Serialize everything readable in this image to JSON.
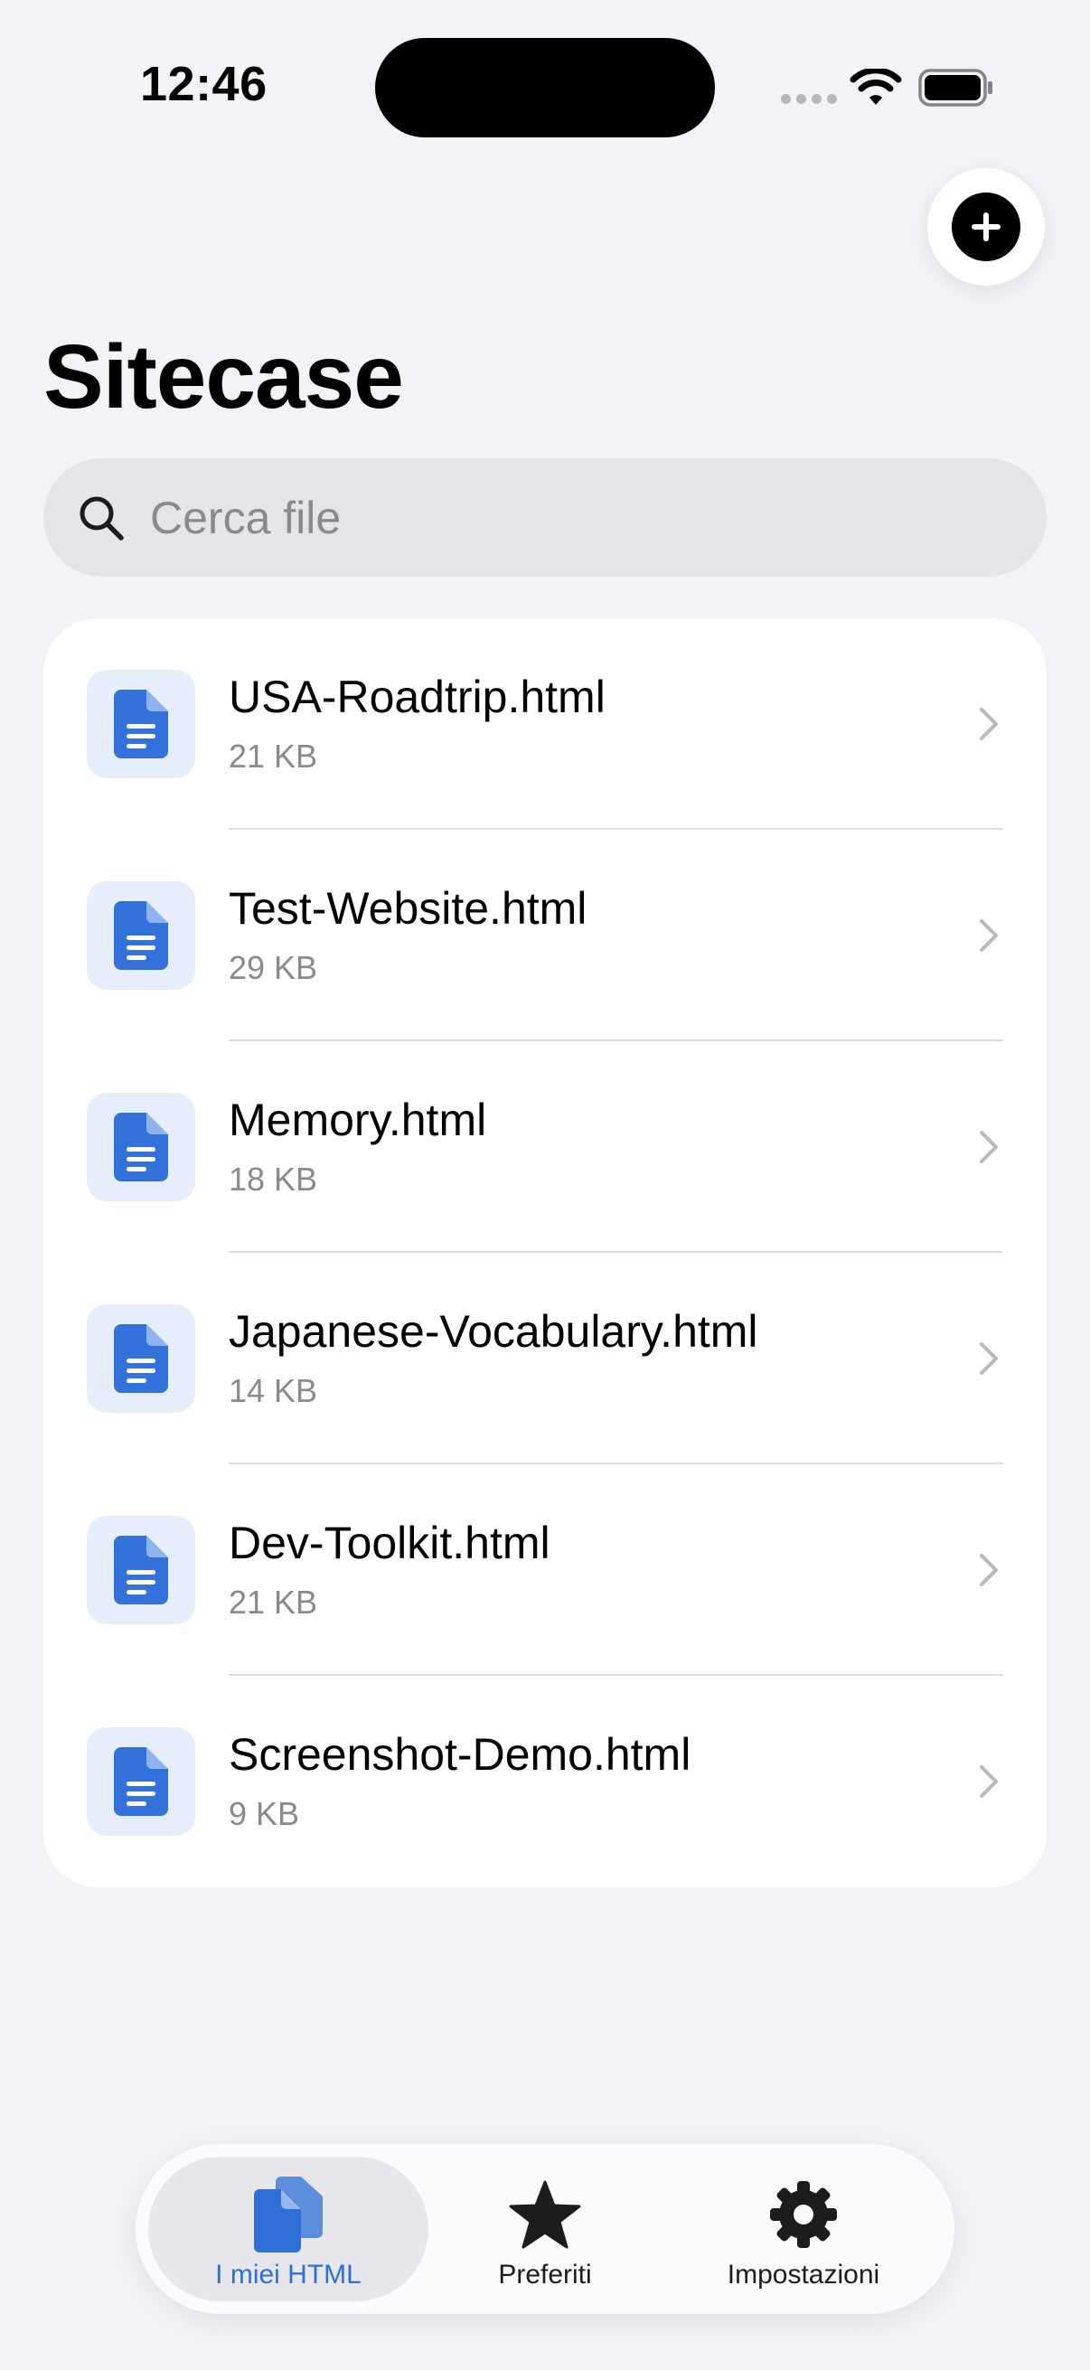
{
  "status_bar": {
    "time": "12:46"
  },
  "header": {
    "title": "Sitecase"
  },
  "search": {
    "placeholder": "Cerca file",
    "value": ""
  },
  "files": [
    {
      "name": "USA-Roadtrip.html",
      "size": "21 KB"
    },
    {
      "name": "Test-Website.html",
      "size": "29 KB"
    },
    {
      "name": "Memory.html",
      "size": "18 KB"
    },
    {
      "name": "Japanese-Vocabulary.html",
      "size": "14 KB"
    },
    {
      "name": "Dev-Toolkit.html",
      "size": "21 KB"
    },
    {
      "name": "Screenshot-Demo.html",
      "size": "9 KB"
    }
  ],
  "tab_bar": {
    "tabs": [
      {
        "label": "I miei HTML",
        "icon": "documents-icon",
        "active": true
      },
      {
        "label": "Preferiti",
        "icon": "star-icon",
        "active": false
      },
      {
        "label": "Impostazioni",
        "icon": "gear-icon",
        "active": false
      }
    ]
  },
  "colors": {
    "accent": "#2f6fd8",
    "file_icon": "#3472db",
    "file_icon_bg": "#e6eefb",
    "background": "#f2f2f7"
  }
}
